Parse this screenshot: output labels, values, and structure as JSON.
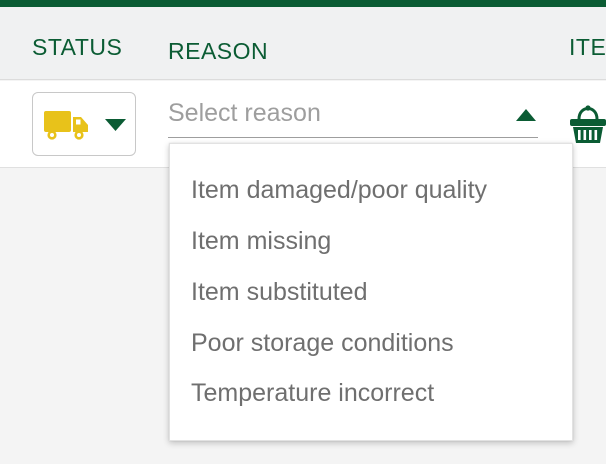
{
  "colors": {
    "brand_green": "#0b5c34",
    "truck_yellow": "#e8c21a"
  },
  "table": {
    "columns": {
      "status": "STATUS",
      "reason": "REASON",
      "items": "ITE"
    }
  },
  "row": {
    "status_icon": "truck-icon",
    "reason_placeholder": "Select reason",
    "items_icon": "basket-icon"
  },
  "reason_dropdown": {
    "open": true,
    "options": [
      "Item damaged/poor quality",
      "Item missing",
      "Item substituted",
      "Poor storage conditions",
      "Temperature incorrect"
    ]
  }
}
